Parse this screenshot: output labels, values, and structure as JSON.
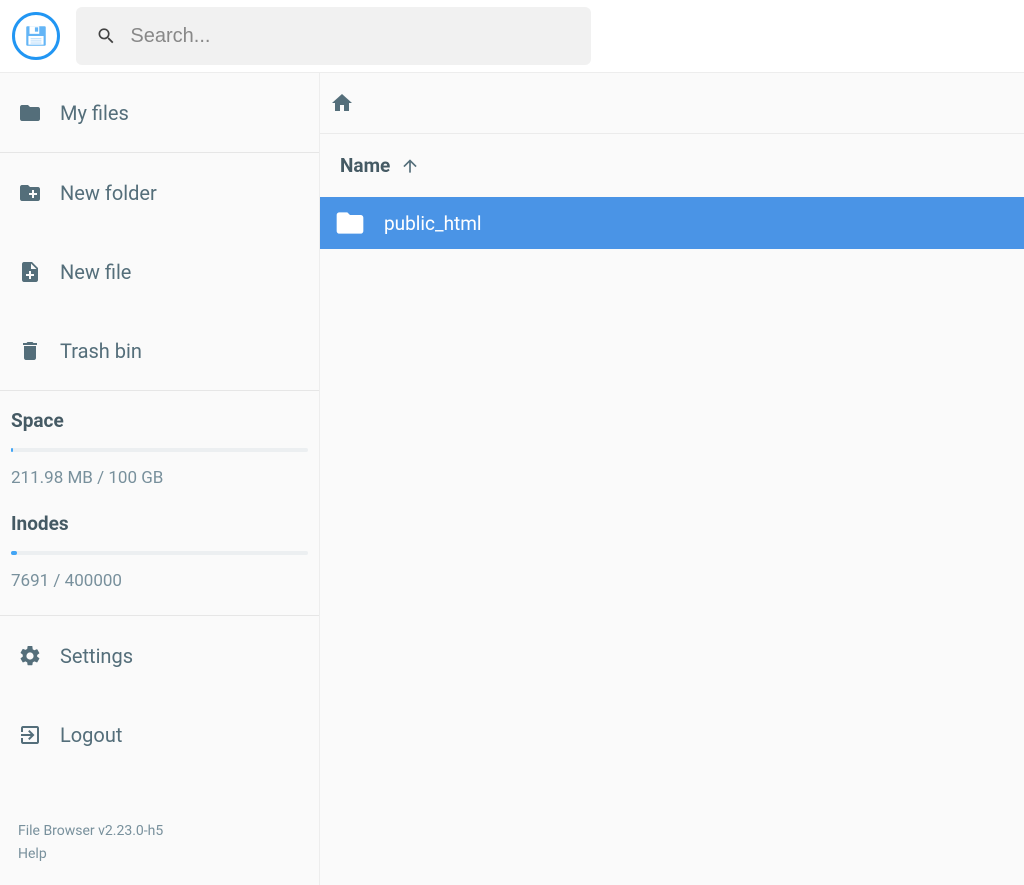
{
  "search": {
    "placeholder": "Search..."
  },
  "sidebar": {
    "my_files": "My files",
    "new_folder": "New folder",
    "new_file": "New file",
    "trash_bin": "Trash bin",
    "space_title": "Space",
    "space_text": "211.98 MB / 100 GB",
    "inodes_title": "Inodes",
    "inodes_text": "7691 / 400000",
    "settings": "Settings",
    "logout": "Logout",
    "version": "File Browser v2.23.0-h5",
    "help": "Help"
  },
  "listing": {
    "name_header": "Name",
    "items": [
      {
        "label": "public_html",
        "type": "folder",
        "selected": true
      }
    ]
  }
}
